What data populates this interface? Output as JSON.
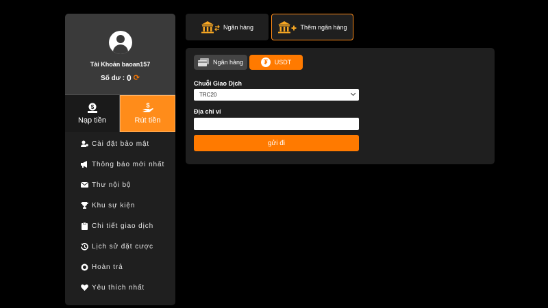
{
  "account": {
    "label": "Tài Khoản",
    "username": "baoan157",
    "balance_label": "Số dư :",
    "balance_value": "0"
  },
  "actions": {
    "deposit_label": "Nạp tiền",
    "withdraw_label": "Rút tiền"
  },
  "menu": [
    {
      "label": "Cài đặt bảo mật",
      "icon": "user-cog-icon"
    },
    {
      "label": "Thông báo mới nhất",
      "icon": "megaphone-icon"
    },
    {
      "label": "Thư nội bộ",
      "icon": "envelope-icon"
    },
    {
      "label": "Khu sự kiện",
      "icon": "trophy-icon"
    },
    {
      "label": "Chi tiết giao dịch",
      "icon": "clipboard-icon"
    },
    {
      "label": "Lịch sử đặt cược",
      "icon": "history-icon"
    },
    {
      "label": "Hoàn trả",
      "icon": "coins-icon"
    },
    {
      "label": "Yêu thích nhất",
      "icon": "heart-icon"
    }
  ],
  "top_tabs": {
    "bank_label": "Ngân hàng",
    "add_bank_label": "Thêm ngân hàng"
  },
  "panel": {
    "subtab_bank": "Ngân hàng",
    "subtab_usdt": "USDT",
    "chain_label": "Chuỗi Giao Dịch",
    "chain_value": "TRC20",
    "wallet_label": "Địa chỉ ví",
    "wallet_value": "",
    "submit_label": "gửi đi"
  },
  "colors": {
    "accent": "#ff7a00",
    "bank_icon": "#f5a623",
    "background": "#000000",
    "panel": "#1f1f1f",
    "profile": "#3a3a3a"
  }
}
